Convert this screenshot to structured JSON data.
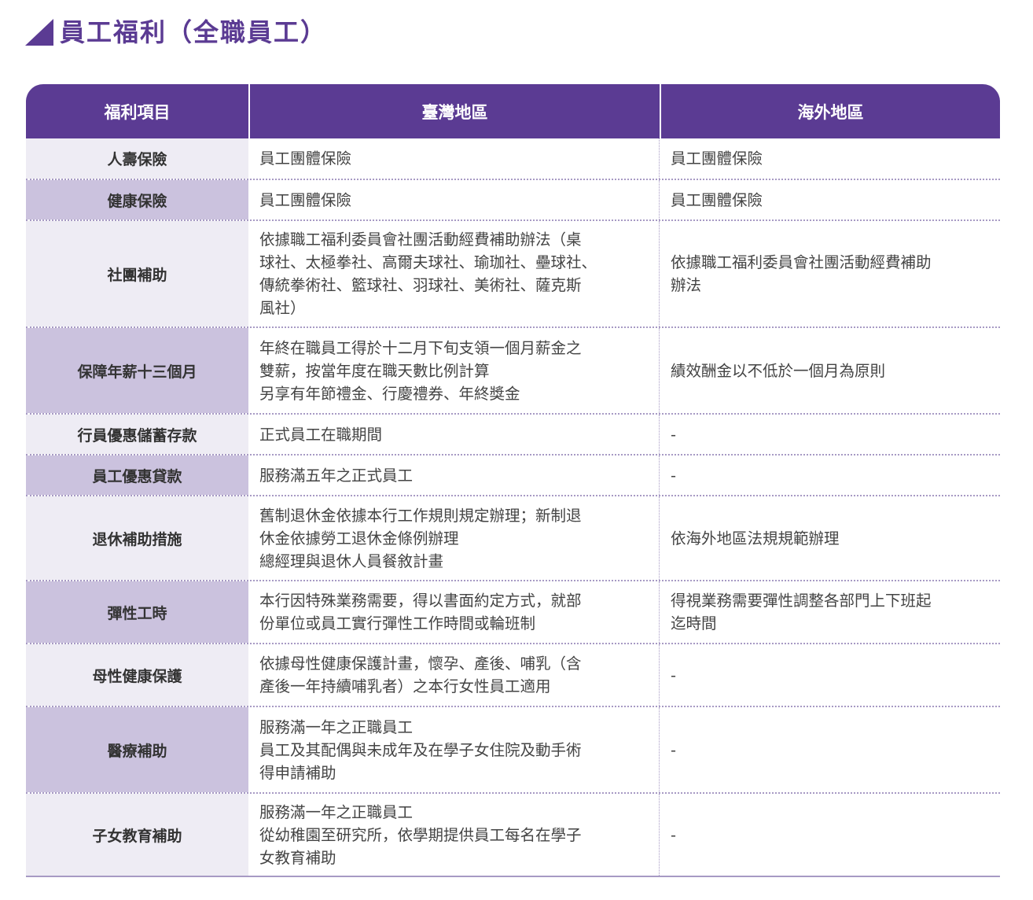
{
  "title": "員工福利（全職員工）",
  "colors": {
    "accent": "#5b3b93",
    "row_light": "#eeecf4",
    "row_dark": "#cbc2de"
  },
  "headers": [
    "福利項目",
    "臺灣地區",
    "海外地區"
  ],
  "rows": [
    {
      "item": "人壽保險",
      "taiwan": [
        "員工團體保險"
      ],
      "overseas": [
        "員工團體保險"
      ]
    },
    {
      "item": "健康保險",
      "taiwan": [
        "員工團體保險"
      ],
      "overseas": [
        "員工團體保險"
      ]
    },
    {
      "item": "社團補助",
      "taiwan": [
        "依據職工福利委員會社團活動經費補助辦法（桌",
        "球社、太極拳社、高爾夫球社、瑜珈社、壘球社、",
        "傳統拳術社、籃球社、羽球社、美術社、薩克斯",
        "風社）"
      ],
      "overseas": [
        "依據職工福利委員會社團活動經費補助",
        "辦法"
      ]
    },
    {
      "item": "保障年薪十三個月",
      "taiwan": [
        "年終在職員工得於十二月下旬支領一個月薪金之",
        "雙薪，按當年度在職天數比例計算",
        "另享有年節禮金、行慶禮券、年終獎金"
      ],
      "overseas": [
        "績效酬金以不低於一個月為原則"
      ]
    },
    {
      "item": "行員優惠儲蓄存款",
      "taiwan": [
        "正式員工在職期間"
      ],
      "overseas": [
        "-"
      ]
    },
    {
      "item": "員工優惠貸款",
      "taiwan": [
        "服務滿五年之正式員工"
      ],
      "overseas": [
        "-"
      ]
    },
    {
      "item": "退休補助措施",
      "taiwan": [
        "舊制退休金依據本行工作規則規定辦理；新制退",
        "休金依據勞工退休金條例辦理",
        "總經理與退休人員餐敘計畫"
      ],
      "overseas": [
        "依海外地區法規規範辦理"
      ]
    },
    {
      "item": "彈性工時",
      "taiwan": [
        "本行因特殊業務需要，得以書面約定方式，就部",
        "份單位或員工實行彈性工作時間或輪班制"
      ],
      "overseas": [
        "得視業務需要彈性調整各部門上下班起",
        "迄時間"
      ]
    },
    {
      "item": "母性健康保護",
      "taiwan": [
        "依據母性健康保護計畫，懷孕、產後、哺乳（含",
        "產後一年持續哺乳者）之本行女性員工適用"
      ],
      "overseas": [
        "-"
      ]
    },
    {
      "item": "醫療補助",
      "taiwan": [
        "服務滿一年之正職員工",
        "員工及其配偶與未成年及在學子女住院及動手術",
        "得申請補助"
      ],
      "overseas": [
        "-"
      ]
    },
    {
      "item": "子女教育補助",
      "taiwan": [
        "服務滿一年之正職員工",
        "從幼稚園至研究所，依學期提供員工每名在學子",
        "女教育補助"
      ],
      "overseas": [
        "-"
      ]
    }
  ]
}
